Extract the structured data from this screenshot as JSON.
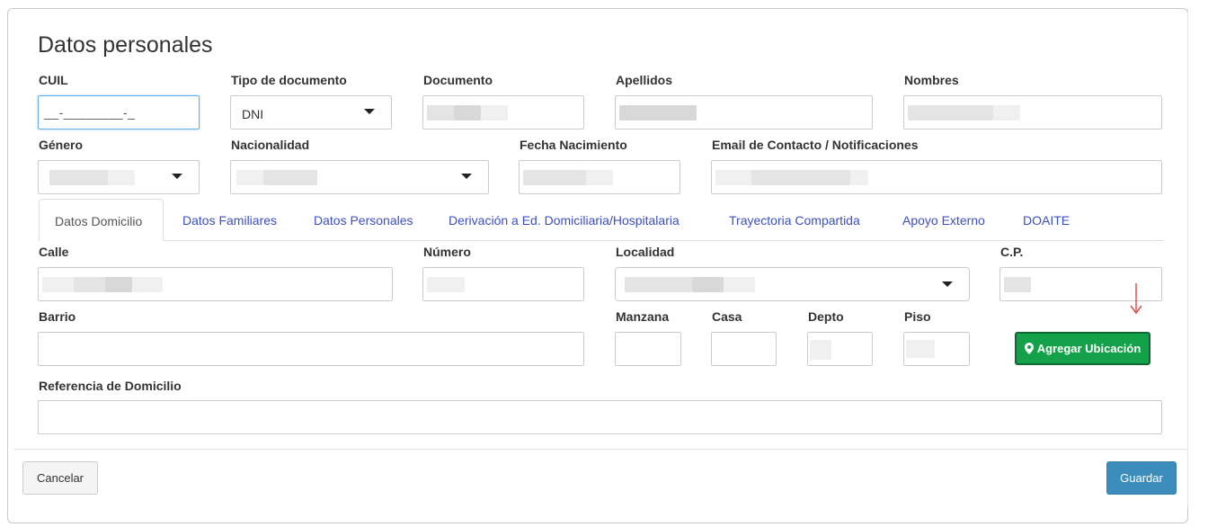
{
  "section_title": "Datos personales",
  "labels": {
    "cuil": "CUIL",
    "tipo_documento": "Tipo de documento",
    "documento": "Documento",
    "apellidos": "Apellidos",
    "nombres": "Nombres",
    "genero": "Género",
    "nacionalidad": "Nacionalidad",
    "fecha_nacimiento": "Fecha Nacimiento",
    "email": "Email de Contacto / Notificaciones",
    "calle": "Calle",
    "numero": "Número",
    "localidad": "Localidad",
    "cp": "C.P.",
    "barrio": "Barrio",
    "manzana": "Manzana",
    "casa": "Casa",
    "depto": "Depto",
    "piso": "Piso",
    "referencia": "Referencia de Domicilio"
  },
  "values": {
    "cuil_mask": "__-________-_",
    "tipo_documento": "DNI"
  },
  "tabs": [
    {
      "label": "Datos Domicilio",
      "active": true
    },
    {
      "label": "Datos Familiares",
      "active": false
    },
    {
      "label": "Datos Personales",
      "active": false
    },
    {
      "label": "Derivación a Ed. Domiciliaria/Hospitalaria",
      "active": false
    },
    {
      "label": "Trayectoria Compartida",
      "active": false
    },
    {
      "label": "Apoyo Externo",
      "active": false
    },
    {
      "label": "DOAITE",
      "active": false
    }
  ],
  "buttons": {
    "agregar_ubicacion": "Agregar Ubicación",
    "cancelar": "Cancelar",
    "guardar": "Guardar"
  },
  "colors": {
    "tab_link": "#3c4fc4",
    "green_button": "#13a24a",
    "save_button": "#3c8dbc",
    "annotation_arrow": "#d9534f"
  },
  "icons": {
    "location": "map-marker-icon",
    "select": "caret-down-icon"
  }
}
